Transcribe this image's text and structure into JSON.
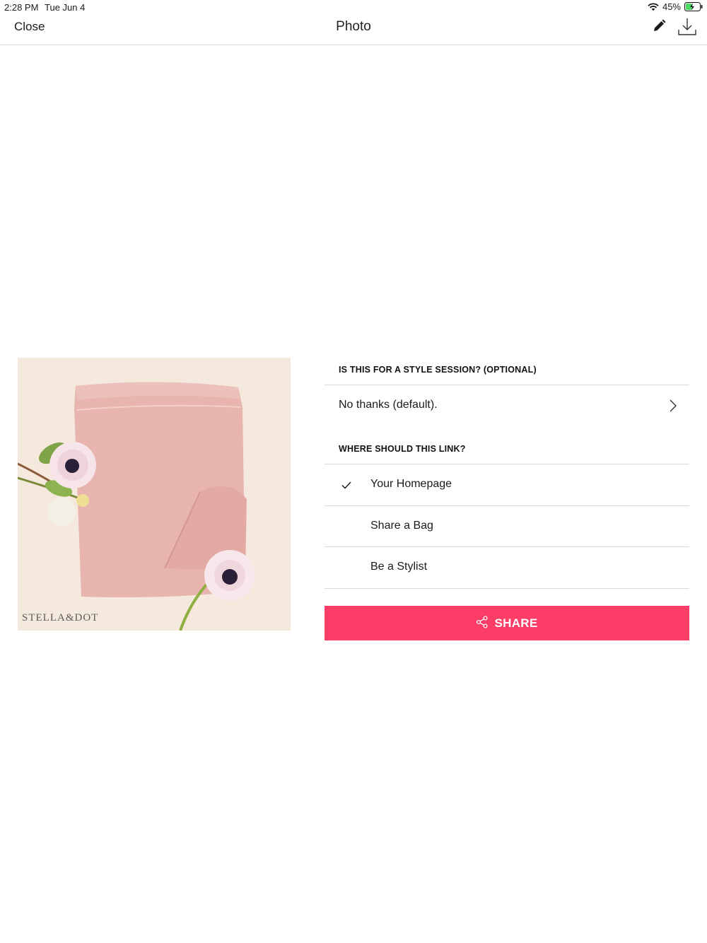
{
  "status_bar": {
    "time": "2:28 PM",
    "date": "Tue Jun 4",
    "battery_percent": "45%",
    "battery_level": 0.45,
    "icons": [
      "wifi-icon",
      "battery-charging-icon"
    ]
  },
  "nav": {
    "close_label": "Close",
    "title": "Photo",
    "icons": [
      "edit-icon",
      "download-icon"
    ]
  },
  "photo": {
    "watermark": "STELLA&DOT"
  },
  "style_session": {
    "header": "IS THIS FOR A STYLE SESSION? (OPTIONAL)",
    "selected_value": "No thanks (default)."
  },
  "link_target": {
    "header": "WHERE SHOULD THIS LINK?",
    "options": [
      {
        "label": "Your Homepage",
        "selected": true
      },
      {
        "label": "Share a Bag",
        "selected": false
      },
      {
        "label": "Be a Stylist",
        "selected": false
      }
    ]
  },
  "share_button": {
    "label": "SHARE",
    "color": "#fb3d67"
  }
}
